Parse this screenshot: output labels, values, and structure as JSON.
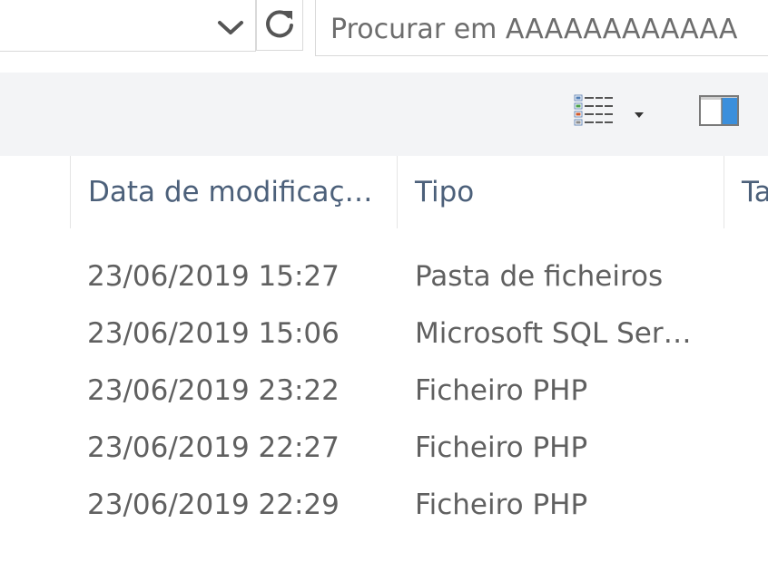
{
  "search": {
    "placeholder": "Procurar em AAAAAAAAAAAA"
  },
  "icons": {
    "dropdown": "chevron-down-icon",
    "refresh": "refresh-icon",
    "view": "details-view-icon",
    "view_dropdown": "caret-down-icon",
    "pane": "preview-pane-icon"
  },
  "colors": {
    "header_text": "#4c607a",
    "row_text": "#606060",
    "toolbar_bg": "#f3f4f6",
    "accent": "#3b8fdc"
  },
  "columns": {
    "date": "Data de modificaç…",
    "type": "Tipo",
    "size": "Ta"
  },
  "rows": [
    {
      "date": "23/06/2019 15:27",
      "type": "Pasta de ficheiros"
    },
    {
      "date": "23/06/2019 15:06",
      "type": "Microsoft SQL Ser…"
    },
    {
      "date": "23/06/2019 23:22",
      "type": "Ficheiro PHP"
    },
    {
      "date": "23/06/2019 22:27",
      "type": "Ficheiro PHP"
    },
    {
      "date": "23/06/2019 22:29",
      "type": "Ficheiro PHP"
    }
  ]
}
